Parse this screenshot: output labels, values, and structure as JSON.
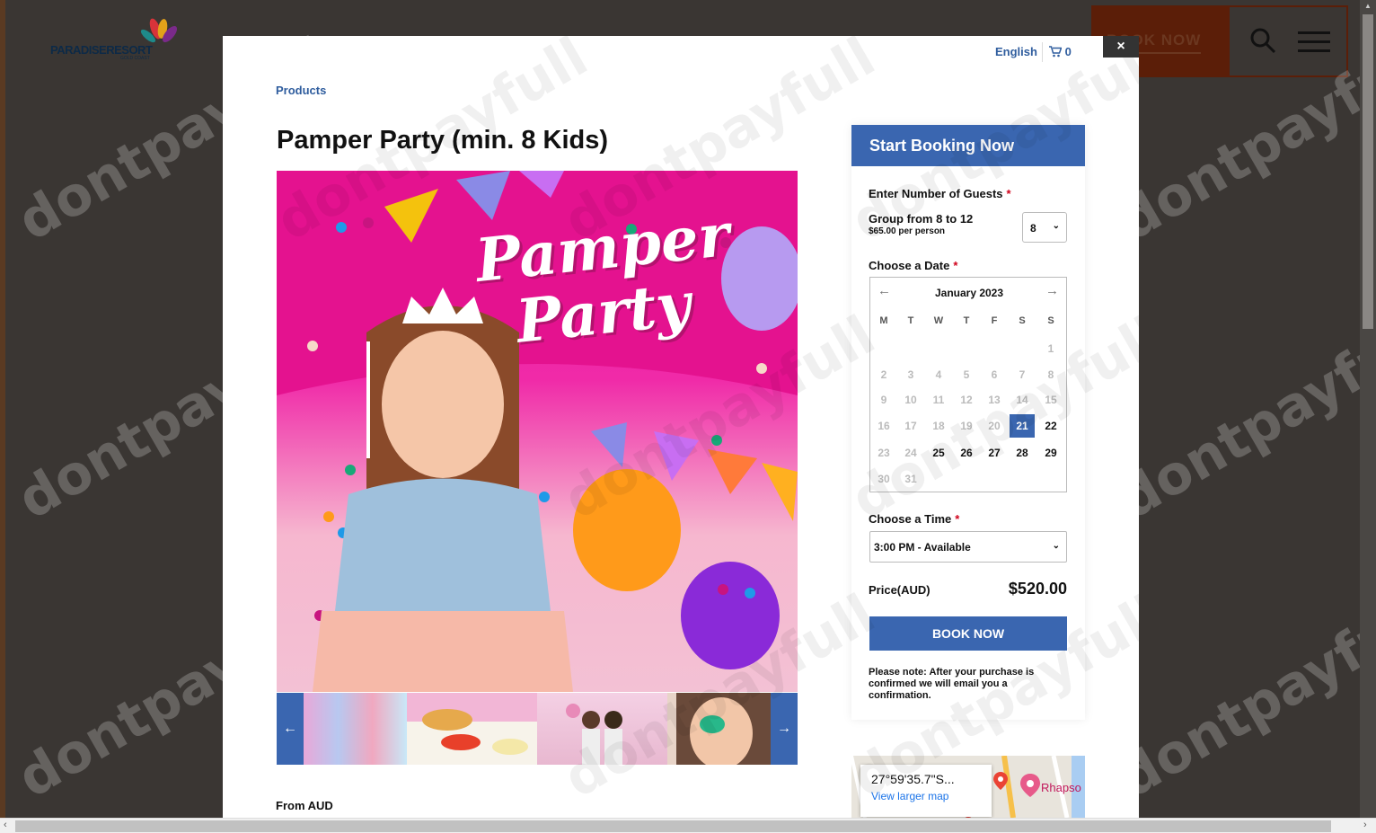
{
  "site": {
    "logo_text": "PARADISERESORT",
    "logo_sub": "GOLD COAST",
    "book_now": "BOOK NOW"
  },
  "modal": {
    "close": "×",
    "language": "English",
    "cart_count": "0",
    "breadcrumb": "Products",
    "title": "Pamper Party (min. 8 Kids)",
    "hero_text_1": "Pamper",
    "hero_text_2": "Party",
    "from_label": "From AUD",
    "thumb_prev": "←",
    "thumb_next": "→"
  },
  "booking": {
    "header": "Start Booking Now",
    "guests_label": "Enter Number of Guests",
    "group_label": "Group from 8 to 12",
    "group_price": "$65.00 per person",
    "guest_value": "8",
    "date_label": "Choose a Date",
    "calendar": {
      "month": "January 2023",
      "dow": [
        "M",
        "T",
        "W",
        "T",
        "F",
        "S",
        "S"
      ],
      "selected": "21",
      "weeks": [
        [
          "",
          "",
          "",
          "",
          "",
          "",
          "1"
        ],
        [
          "2",
          "3",
          "4",
          "5",
          "6",
          "7",
          "8"
        ],
        [
          "9",
          "10",
          "11",
          "12",
          "13",
          "14",
          "15"
        ],
        [
          "16",
          "17",
          "18",
          "19",
          "20",
          "21",
          "22"
        ],
        [
          "23",
          "24",
          "25",
          "26",
          "27",
          "28",
          "29"
        ],
        [
          "30",
          "31",
          "",
          "",
          "",
          "",
          ""
        ]
      ],
      "available": [
        "21",
        "22",
        "25",
        "26",
        "27",
        "28",
        "29"
      ]
    },
    "time_label": "Choose a Time",
    "time_value": "3:00 PM - Available",
    "price_label": "Price(AUD)",
    "price_value": "$520.00",
    "book_button": "BOOK NOW",
    "note": "Please note: After your purchase is confirmed we will email you a confirmation."
  },
  "map": {
    "coords": "27°59'35.7\"S...",
    "link": "View larger map",
    "place": "Rhapso"
  },
  "colors": {
    "accent": "#3a66b0",
    "required": "#d0021b",
    "hero_pink": "#e0199a"
  }
}
